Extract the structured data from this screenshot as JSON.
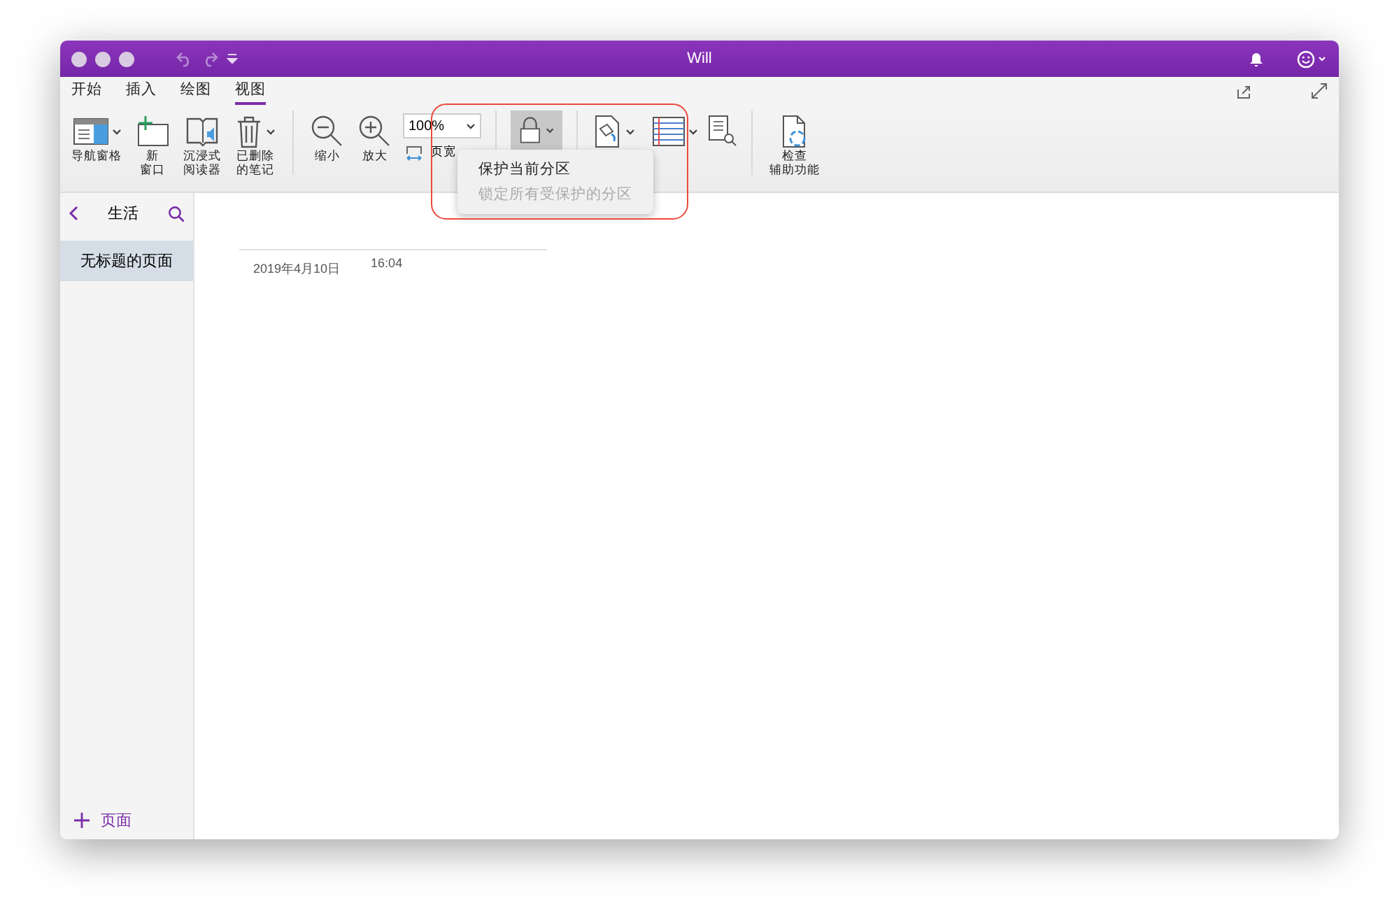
{
  "window": {
    "title": "Will"
  },
  "tabs": [
    {
      "label": "开始",
      "selected": false
    },
    {
      "label": "插入",
      "selected": false
    },
    {
      "label": "绘图",
      "selected": false
    },
    {
      "label": "视图",
      "selected": true
    }
  ],
  "ribbon": {
    "view_items": [
      {
        "label": [
          "导航窗格"
        ],
        "has_menu": true
      },
      {
        "label": [
          "新",
          "窗口"
        ],
        "has_menu": false
      },
      {
        "label": [
          "沉浸式",
          "阅读器"
        ],
        "has_menu": false
      },
      {
        "label": [
          "已删除",
          "的笔记"
        ],
        "has_menu": true
      }
    ],
    "zoom_out": "缩小",
    "zoom_in": "放大",
    "zoom_value": "100%",
    "page_width": "页宽",
    "lock": {
      "pressed": true
    },
    "accessibility": [
      "检查",
      "辅助功能"
    ]
  },
  "lock_menu": [
    {
      "label": "保护当前分区",
      "disabled": false
    },
    {
      "label": "锁定所有受保护的分区",
      "disabled": true
    }
  ],
  "sidebar": {
    "notebook": "生活",
    "pages": [
      {
        "title": "无标题的页面",
        "selected": true
      }
    ],
    "add_page": "页面"
  },
  "page": {
    "date": "2019年4月10日",
    "time": "16:04"
  }
}
